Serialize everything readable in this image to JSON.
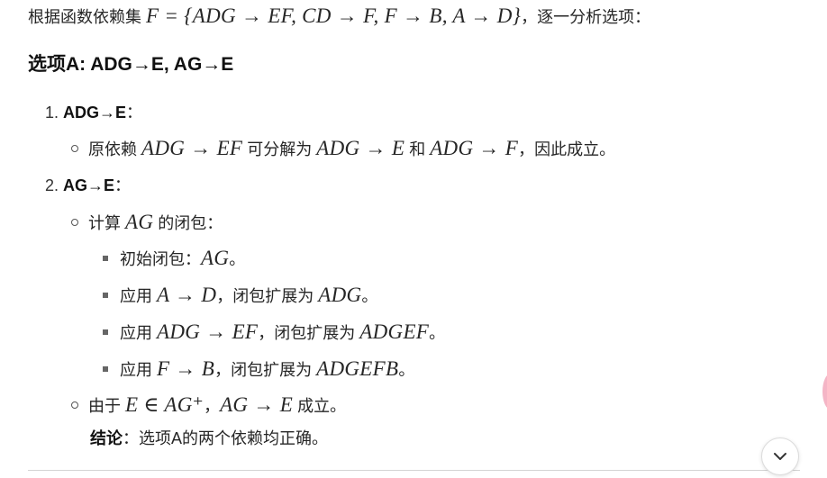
{
  "intro": {
    "text_before": "根据函数依赖集",
    "formula": "F = {ADG → EF, CD → F, F → B, A → D}",
    "text_after": "，逐一分析选项："
  },
  "section_title": "选项A: ADG→E, AG→E",
  "items": [
    {
      "number": "1.",
      "label": "ADG→E",
      "colon": "：",
      "sub": {
        "t1": "原依赖",
        "m1": "ADG → EF",
        "t2": "可分解为",
        "m2": "ADG → E",
        "t3": "和",
        "m3": "ADG → F",
        "t4": "，因此成立。"
      }
    },
    {
      "number": "2.",
      "label": "AG→E",
      "colon": "：",
      "closure": {
        "t1": "计算",
        "m1": "AG",
        "t2": "的闭包："
      },
      "steps": [
        {
          "text": "初始闭包：",
          "math": "AG",
          "tail": "。"
        },
        {
          "text": "应用",
          "math": "A → D",
          "mid": "，闭包扩展为",
          "math2": "ADG",
          "tail": "。"
        },
        {
          "text": "应用",
          "math": "ADG → EF",
          "mid": "，闭包扩展为",
          "math2": "ADGEF",
          "tail": "。"
        },
        {
          "text": "应用",
          "math": "F → B",
          "mid": "，闭包扩展为",
          "math2": "ADGEFB",
          "tail": "。"
        }
      ],
      "since": {
        "t1": "由于",
        "m1": "E ∈ AG⁺",
        "t2": "，",
        "m2": "AG → E",
        "t3": "成立。"
      }
    }
  ],
  "conclusion": {
    "label": "结论",
    "text": "：选项A的两个依赖均正确。"
  },
  "scroll_button": {
    "icon": "chevron-down-icon"
  },
  "colors": {
    "text": "#262626",
    "accent_blob": "#f4b5c6",
    "divider": "#d4d4d4"
  }
}
